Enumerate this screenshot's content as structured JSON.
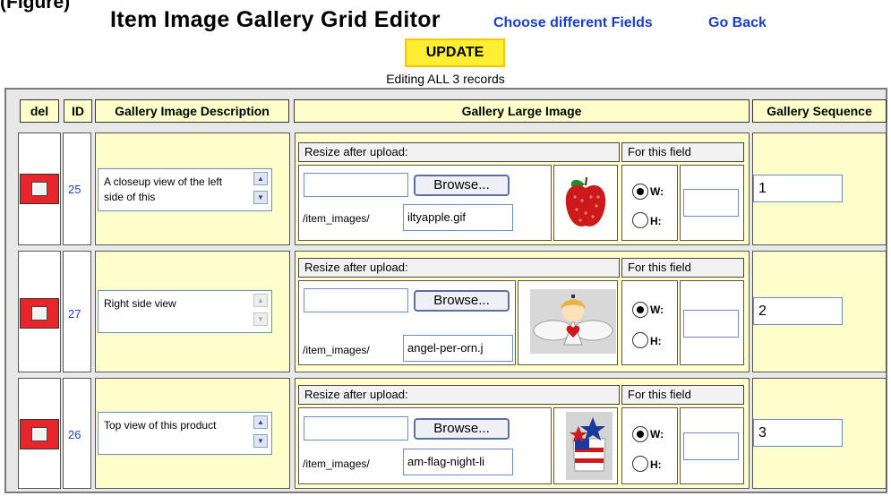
{
  "top_cutoff_text": "(Figure)",
  "header": {
    "title": "Item Image Gallery Grid Editor",
    "choose_fields_link": "Choose different Fields",
    "go_back_link": "Go Back"
  },
  "update_button": "UPDATE",
  "editing_message": "Editing ALL 3 records",
  "columns": {
    "del": "del",
    "id": "ID",
    "description": "Gallery Image Description",
    "large_image": "Gallery Large Image",
    "sequence": "Gallery Sequence"
  },
  "labels": {
    "resize_after_upload": "Resize after upload:",
    "for_this_field": "For this field",
    "browse": "Browse...",
    "path_prefix": "/item_images/",
    "width": "W:",
    "height": "H:"
  },
  "rows": [
    {
      "id": "25",
      "description": "A closeup view of the left side of this",
      "filename": "iltyapple.gif",
      "thumbnail": "apple-thumbnail",
      "sequence": "1",
      "resize_selected": "W"
    },
    {
      "id": "27",
      "description": "Right side view",
      "filename": "angel-per-orn.j",
      "thumbnail": "angel-ornament-thumbnail",
      "sequence": "2",
      "resize_selected": "W"
    },
    {
      "id": "26",
      "description": "Top view of this product",
      "filename": "am-flag-night-li",
      "thumbnail": "flag-ornament-thumbnail",
      "sequence": "3",
      "resize_selected": "W"
    }
  ],
  "colors": {
    "header_cell_bg": "#ffffcc",
    "update_button_bg": "#ffee33",
    "delete_box": "#e8252a",
    "link": "#1a3fd0"
  }
}
